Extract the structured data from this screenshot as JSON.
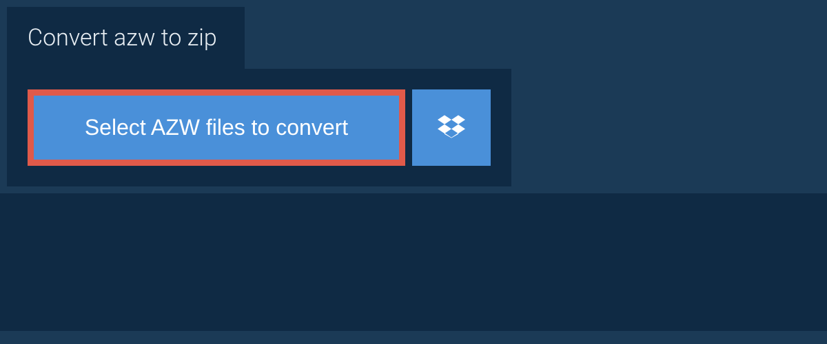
{
  "tab": {
    "title": "Convert azw to zip"
  },
  "panel": {
    "select_button_label": "Select AZW files to convert",
    "dropbox_icon": "dropbox-icon"
  },
  "colors": {
    "background": "#1b3a56",
    "panel": "#0f2a44",
    "button": "#4a90d9",
    "button_text": "#ffffff",
    "tab_text": "#e8eef3",
    "highlight_border": "#e05a4a"
  }
}
